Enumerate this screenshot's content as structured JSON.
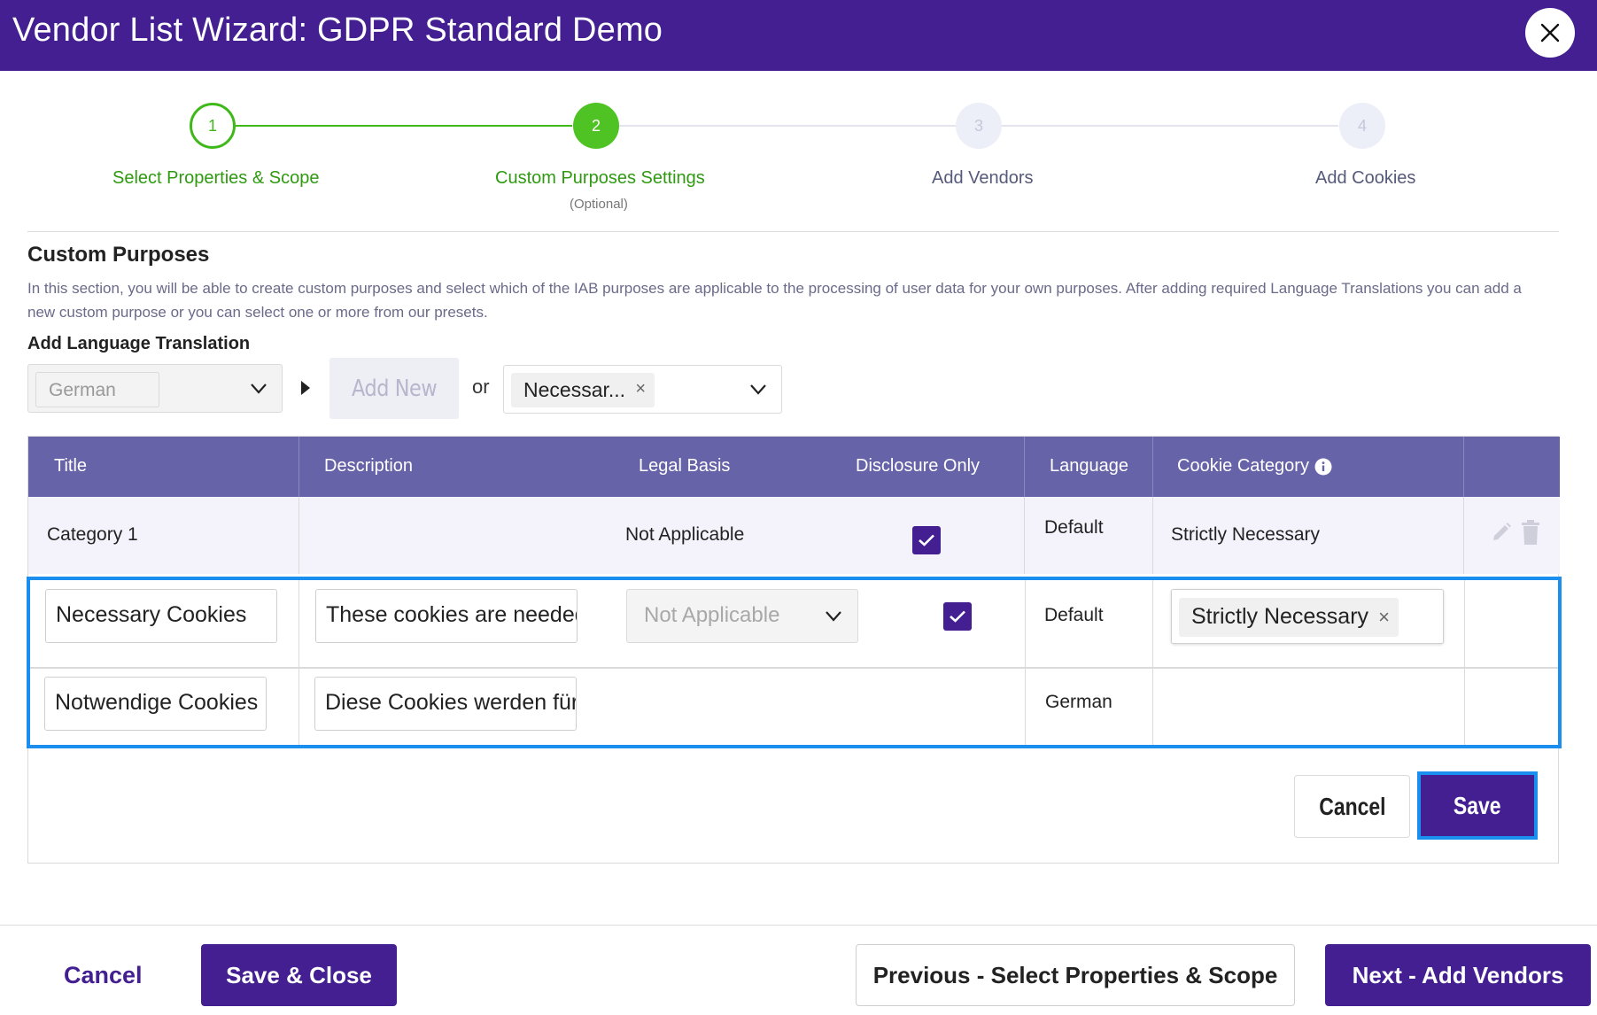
{
  "header": {
    "title": "Vendor List Wizard: GDPR Standard Demo"
  },
  "stepper": {
    "steps": [
      {
        "number": "1",
        "label": "Select Properties & Scope",
        "sub": ""
      },
      {
        "number": "2",
        "label": "Custom Purposes Settings",
        "sub": "(Optional)"
      },
      {
        "number": "3",
        "label": "Add Vendors",
        "sub": ""
      },
      {
        "number": "4",
        "label": "Add Cookies",
        "sub": ""
      }
    ]
  },
  "section": {
    "title": "Custom Purposes",
    "description": "In this section, you will be able to create custom purposes and select which of the IAB purposes are applicable to the processing of user data for your own purposes. After adding required Language Translations you can add a new custom purpose or you can select one or more from our presets."
  },
  "language": {
    "title": "Add Language Translation",
    "selected": "German",
    "add_new_label": "Add New",
    "or_label": "or",
    "preset_chip": "Necessar...",
    "chip_remove": "×"
  },
  "table": {
    "headers": {
      "title": "Title",
      "description": "Description",
      "legal_basis": "Legal Basis",
      "disclosure_only": "Disclosure Only",
      "language": "Language",
      "cookie_category": "Cookie Category"
    },
    "rows": [
      {
        "title": "Category 1",
        "legal_basis": "Not Applicable",
        "language": "Default",
        "cookie_category": "Strictly Necessary"
      }
    ],
    "edit_rows": [
      {
        "title": "Necessary Cookies",
        "description": "These cookies are needed",
        "legal_basis": "Not Applicable",
        "language": "Default",
        "cookie_category": "Strictly Necessary"
      },
      {
        "title": "Notwendige Cookies",
        "description": "Diese Cookies werden für",
        "language": "German"
      }
    ],
    "cancel_label": "Cancel",
    "save_label": "Save"
  },
  "footer": {
    "cancel_label": "Cancel",
    "save_close_label": "Save & Close",
    "previous_label": "Previous - Select Properties & Scope",
    "next_label": "Next - Add Vendors"
  },
  "colors": {
    "brand": "#431f91",
    "step_done": "#3fb91a",
    "table_header": "#6763a8",
    "focus": "#1a8ff0"
  }
}
